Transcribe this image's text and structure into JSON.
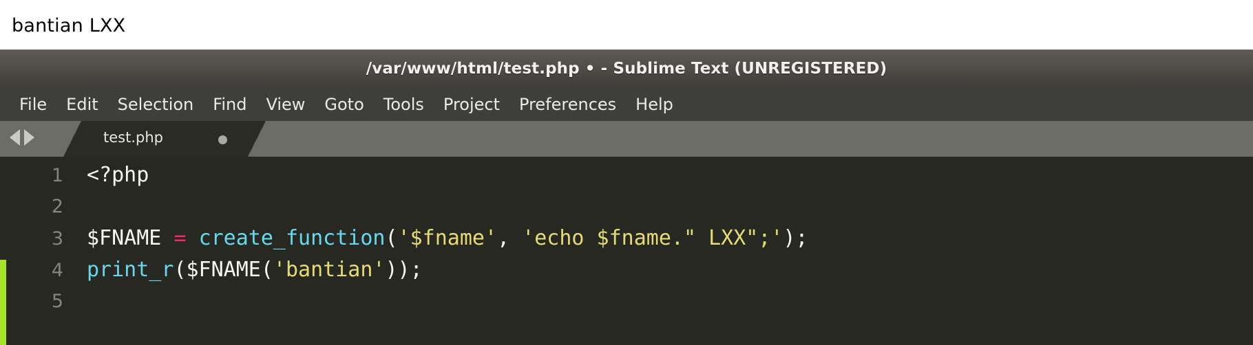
{
  "browser_output": {
    "text": "bantian LXX"
  },
  "window": {
    "title": "/var/www/html/test.php • - Sublime Text (UNREGISTERED)"
  },
  "menu": {
    "items": [
      {
        "label": "File"
      },
      {
        "label": "Edit"
      },
      {
        "label": "Selection"
      },
      {
        "label": "Find"
      },
      {
        "label": "View"
      },
      {
        "label": "Goto"
      },
      {
        "label": "Tools"
      },
      {
        "label": "Project"
      },
      {
        "label": "Preferences"
      },
      {
        "label": "Help"
      }
    ]
  },
  "tab_bar": {
    "prev_icon": "triangle-left-icon",
    "next_icon": "triangle-right-icon",
    "tabs": [
      {
        "label": "test.php",
        "dirty": true,
        "dirty_icon": "unsaved-dot-icon"
      }
    ]
  },
  "editor": {
    "gutter_numbers": [
      "1",
      "2",
      "3",
      "4",
      "5"
    ],
    "lines": [
      {
        "number": "1",
        "tokens": [
          {
            "text": "<?php",
            "type": "plain"
          }
        ]
      },
      {
        "number": "2",
        "tokens": [
          {
            "text": "",
            "type": "plain"
          }
        ]
      },
      {
        "number": "3",
        "tokens": [
          {
            "text": "$FNAME ",
            "type": "plain"
          },
          {
            "text": "=",
            "type": "op"
          },
          {
            "text": " ",
            "type": "plain"
          },
          {
            "text": "create_function",
            "type": "func"
          },
          {
            "text": "(",
            "type": "punct"
          },
          {
            "text": "'$fname'",
            "type": "string"
          },
          {
            "text": ", ",
            "type": "punct"
          },
          {
            "text": "'echo $fname.\" LXX\";'",
            "type": "string"
          },
          {
            "text": ");",
            "type": "punct"
          }
        ]
      },
      {
        "number": "4",
        "tokens": [
          {
            "text": "print_r",
            "type": "func"
          },
          {
            "text": "($FNAME(",
            "type": "punct"
          },
          {
            "text": "'bantian'",
            "type": "string"
          },
          {
            "text": "));",
            "type": "punct"
          }
        ]
      },
      {
        "number": "5",
        "tokens": [
          {
            "text": "",
            "type": "plain"
          }
        ]
      }
    ],
    "modified_marker_color": "#a6e22a"
  },
  "colors": {
    "titlebar_top": "#5c5953",
    "titlebar_bottom": "#3e3d39",
    "menubar": "#3e3e3a",
    "tabbar": "#6d6d68",
    "tab_active": "#2b2b26",
    "editor_background": "#272822",
    "gutter_text": "#85857c",
    "token_plain": "#f8f8f2",
    "token_function": "#66d9ef",
    "token_operator": "#f92672",
    "token_string": "#e6db74"
  }
}
